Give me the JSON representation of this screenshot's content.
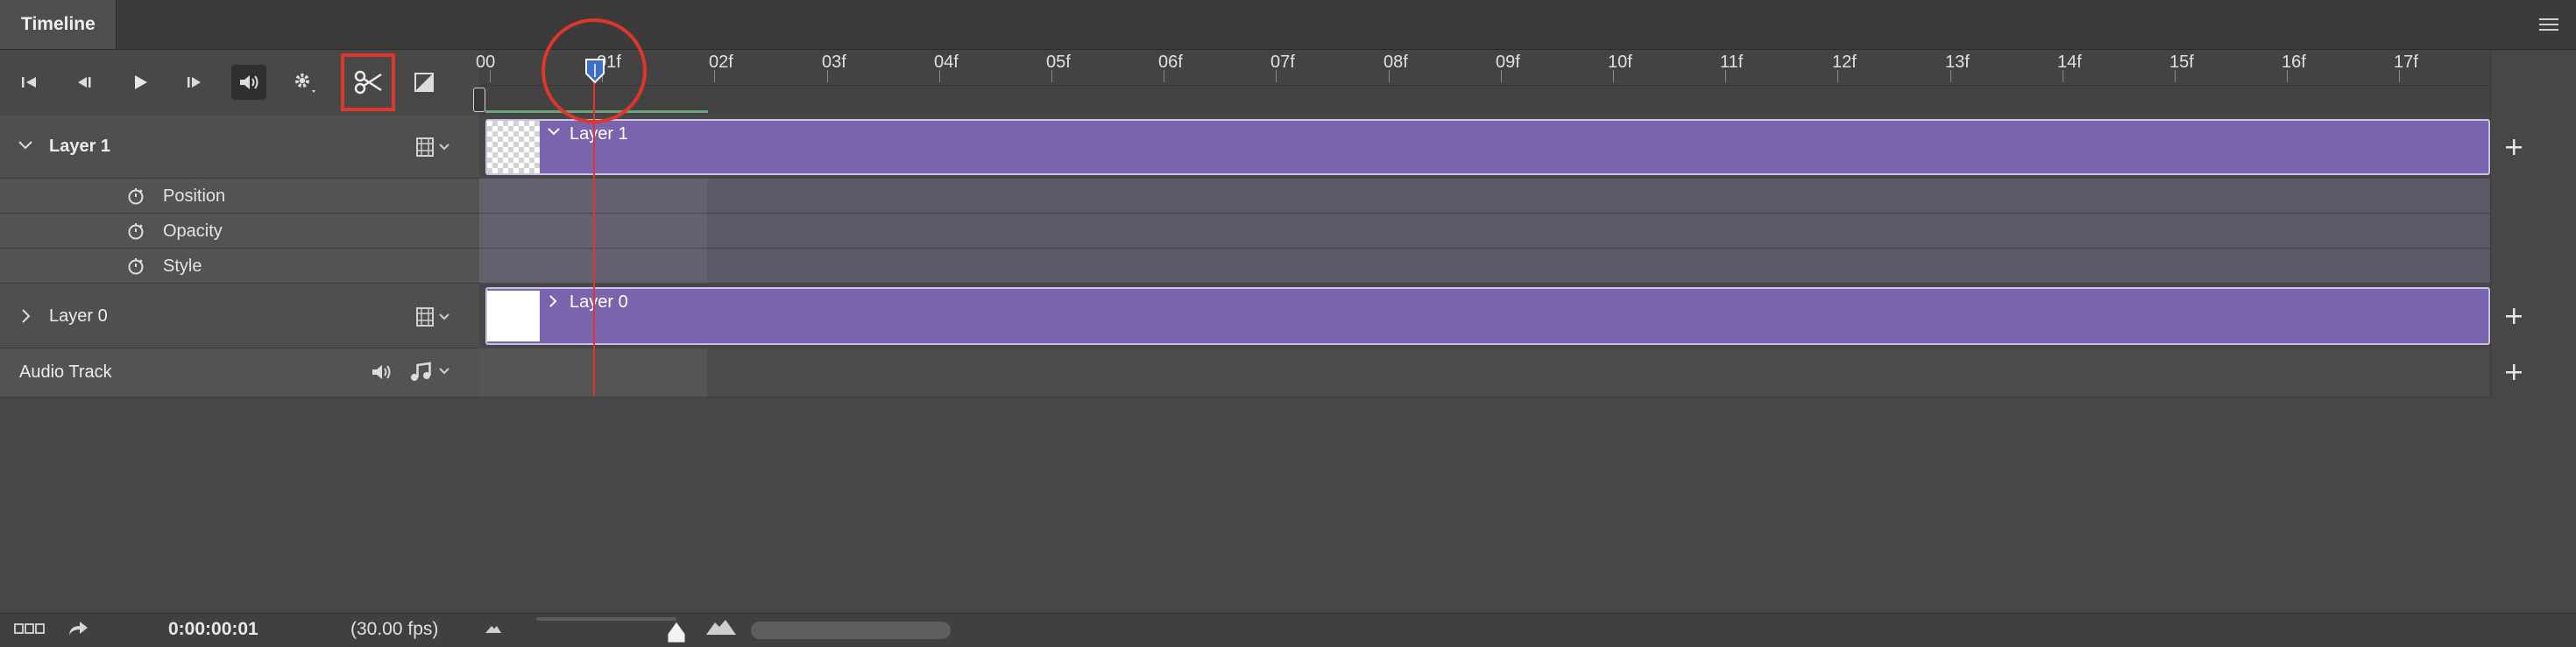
{
  "panel": {
    "title": "Timeline"
  },
  "ruler": {
    "ticks": [
      "00",
      "01f",
      "02f",
      "03f",
      "04f",
      "05f",
      "06f",
      "07f",
      "08f",
      "09f",
      "10f",
      "11f",
      "12f",
      "13f",
      "14f",
      "15f",
      "16f",
      "17f"
    ]
  },
  "controls": {
    "first_frame": "go-to-first-frame-icon",
    "prev_frame": "previous-frame-icon",
    "play": "play-icon",
    "next_frame": "next-frame-icon",
    "audio": "speaker-icon",
    "settings": "gear-icon",
    "split": "scissors-icon",
    "transition": "transition-icon"
  },
  "tracks": {
    "layer1": {
      "name": "Layer 1",
      "clip_label": "Layer 1",
      "properties": [
        "Position",
        "Opacity",
        "Style"
      ]
    },
    "layer0": {
      "name": "Layer 0",
      "clip_label": "Layer 0"
    },
    "audio": {
      "name": "Audio Track"
    }
  },
  "footer": {
    "timecode": "0:00:00:01",
    "fps": "(30.00 fps)"
  },
  "colors": {
    "clip": "#7a64ad",
    "playhead": "#e0352b",
    "highlight": "#e0352b"
  }
}
